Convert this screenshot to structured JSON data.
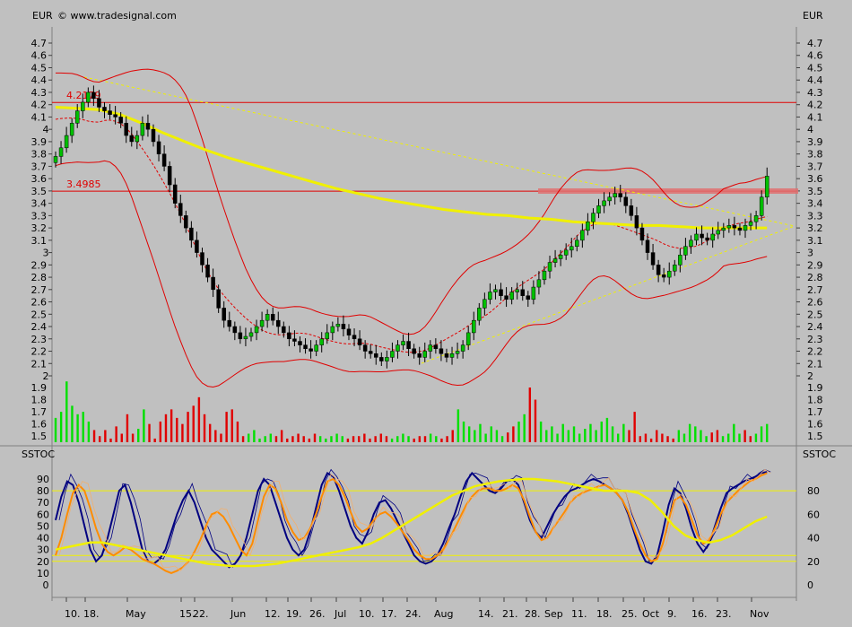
{
  "header": {
    "currency_left": "EUR",
    "currency_right": "EUR",
    "copyright": "© www.tradesignal.com"
  },
  "chart_data": [
    {
      "type": "line",
      "name_panel": "price",
      "y_ticks": [
        2,
        2.1,
        2.2,
        2.3,
        2.4,
        2.5,
        2.6,
        2.7,
        2.8,
        2.9,
        3,
        3.1,
        3.2,
        3.3,
        3.4,
        3.5,
        3.6,
        3.7,
        3.8,
        3.9,
        4,
        4.1,
        4.2,
        4.3,
        4.4,
        4.5,
        4.6,
        4.7
      ],
      "ylim": [
        1.95,
        4.8
      ],
      "x_labels": [
        "10.",
        "18.",
        "May",
        "15.",
        "22.",
        "Jun",
        "12.",
        "19.",
        "26.",
        "Jul",
        "10.",
        "17.",
        "24.",
        "Aug",
        "14.",
        "21.",
        "28.",
        "Sep",
        "11.",
        "18.",
        "25.",
        "Oct",
        "9.",
        "16.",
        "23.",
        "Nov"
      ],
      "horizontal_levels": [
        {
          "label": "4.2179",
          "value": 4.2179,
          "color": "#e00000"
        },
        {
          "label": "3.4985",
          "value": 3.4985,
          "color": "#e00000"
        }
      ],
      "closes": [
        3.78,
        3.85,
        3.95,
        4.05,
        4.15,
        4.22,
        4.3,
        4.25,
        4.18,
        4.15,
        4.12,
        4.1,
        4.05,
        3.95,
        3.9,
        3.95,
        4.05,
        4.0,
        3.9,
        3.8,
        3.7,
        3.55,
        3.4,
        3.3,
        3.2,
        3.1,
        3.0,
        2.9,
        2.8,
        2.7,
        2.55,
        2.45,
        2.4,
        2.35,
        2.3,
        2.32,
        2.35,
        2.4,
        2.45,
        2.5,
        2.45,
        2.4,
        2.35,
        2.3,
        2.28,
        2.25,
        2.22,
        2.2,
        2.25,
        2.3,
        2.35,
        2.4,
        2.42,
        2.38,
        2.33,
        2.3,
        2.25,
        2.2,
        2.18,
        2.15,
        2.12,
        2.15,
        2.2,
        2.25,
        2.28,
        2.22,
        2.18,
        2.15,
        2.2,
        2.25,
        2.22,
        2.18,
        2.15,
        2.18,
        2.2,
        2.25,
        2.35,
        2.45,
        2.55,
        2.62,
        2.68,
        2.7,
        2.65,
        2.62,
        2.68,
        2.7,
        2.65,
        2.62,
        2.72,
        2.78,
        2.85,
        2.92,
        2.95,
        2.98,
        3.02,
        3.05,
        3.1,
        3.18,
        3.25,
        3.32,
        3.38,
        3.42,
        3.45,
        3.48,
        3.45,
        3.38,
        3.3,
        3.2,
        3.1,
        3.0,
        2.9,
        2.82,
        2.8,
        2.85,
        2.9,
        2.98,
        3.05,
        3.1,
        3.15,
        3.12,
        3.1,
        3.15,
        3.18,
        3.2,
        3.22,
        3.2,
        3.18,
        3.22,
        3.25,
        3.3,
        3.45,
        3.62
      ],
      "ma_long": [
        4.18,
        4.17,
        4.16,
        4.12,
        4.05,
        3.97,
        3.9,
        3.83,
        3.77,
        3.72,
        3.67,
        3.62,
        3.57,
        3.52,
        3.48,
        3.44,
        3.41,
        3.38,
        3.35,
        3.33,
        3.31,
        3.3,
        3.28,
        3.27,
        3.25,
        3.24,
        3.23,
        3.22,
        3.22,
        3.21,
        3.2,
        3.2,
        3.2,
        3.2
      ],
      "series": [
        {
          "name": "",
          "color": "#f0f000"
        },
        {
          "name": "",
          "color": "#e00000"
        }
      ]
    },
    {
      "type": "bar",
      "name_panel": "volume",
      "y_ticks": [
        1.5,
        1.6,
        1.7,
        1.8,
        1.9
      ],
      "ylim": [
        1.45,
        2.0
      ],
      "values": [
        1.65,
        1.7,
        1.95,
        1.75,
        1.68,
        1.7,
        1.62,
        1.55,
        1.5,
        1.55,
        1.48,
        1.58,
        1.52,
        1.68,
        1.52,
        1.56,
        1.72,
        1.6,
        1.48,
        1.62,
        1.68,
        1.72,
        1.65,
        1.6,
        1.7,
        1.75,
        1.82,
        1.68,
        1.6,
        1.55,
        1.52,
        1.7,
        1.72,
        1.62,
        1.5,
        1.52,
        1.55,
        1.48,
        1.5,
        1.52,
        1.5,
        1.55,
        1.48,
        1.5,
        1.52,
        1.5,
        1.48,
        1.52,
        1.5,
        1.48,
        1.5,
        1.52,
        1.5,
        1.48,
        1.5,
        1.5,
        1.52,
        1.48,
        1.5,
        1.52,
        1.5,
        1.48,
        1.5,
        1.52,
        1.5,
        1.48,
        1.5,
        1.5,
        1.52,
        1.5,
        1.48,
        1.5,
        1.55,
        1.72,
        1.62,
        1.58,
        1.55,
        1.6,
        1.52,
        1.58,
        1.55,
        1.5,
        1.53,
        1.58,
        1.62,
        1.68,
        1.9,
        1.8,
        1.62,
        1.55,
        1.58,
        1.52,
        1.6,
        1.55,
        1.58,
        1.52,
        1.56,
        1.6,
        1.55,
        1.62,
        1.65,
        1.58,
        1.52,
        1.6,
        1.55,
        1.7,
        1.5,
        1.52,
        1.48,
        1.55,
        1.52,
        1.5,
        1.48,
        1.55,
        1.52,
        1.6,
        1.58,
        1.55,
        1.5,
        1.53,
        1.55,
        1.5,
        1.52,
        1.6,
        1.52,
        1.55,
        1.5,
        1.52,
        1.58,
        1.6
      ]
    },
    {
      "type": "line",
      "name_panel": "SSTOC",
      "label_left": "SSTOC",
      "label_right": "SSTOC",
      "y_ticks_left": [
        0,
        10,
        20,
        30,
        40,
        50,
        60,
        70,
        80,
        90
      ],
      "y_ticks_right": [
        0,
        20,
        40,
        60,
        80
      ],
      "ylim": [
        -5,
        100
      ],
      "horizontal_levels": [
        80,
        20,
        25
      ],
      "series": [
        {
          "name": "",
          "color": "#000080",
          "values": [
            55,
            75,
            88,
            85,
            70,
            50,
            30,
            20,
            25,
            40,
            60,
            80,
            85,
            70,
            50,
            30,
            20,
            18,
            22,
            30,
            45,
            60,
            72,
            80,
            70,
            55,
            40,
            30,
            25,
            20,
            15,
            18,
            25,
            40,
            60,
            80,
            90,
            85,
            70,
            55,
            40,
            30,
            25,
            30,
            45,
            65,
            85,
            95,
            92,
            80,
            65,
            50,
            40,
            35,
            45,
            60,
            70,
            72,
            65,
            55,
            45,
            35,
            25,
            20,
            18,
            20,
            25,
            35,
            48,
            60,
            75,
            88,
            95,
            90,
            85,
            80,
            78,
            82,
            88,
            90,
            85,
            70,
            55,
            45,
            40,
            50,
            60,
            68,
            75,
            80,
            82,
            85,
            88,
            90,
            88,
            85,
            82,
            78,
            72,
            60,
            45,
            30,
            20,
            18,
            25,
            45,
            68,
            82,
            78,
            65,
            48,
            35,
            28,
            35,
            50,
            65,
            78,
            82,
            85,
            88,
            90,
            92,
            95,
            96
          ]
        },
        {
          "name": "",
          "color": "#ff8c00",
          "values": [
            25,
            40,
            60,
            78,
            85,
            80,
            65,
            48,
            35,
            28,
            25,
            28,
            32,
            30,
            26,
            22,
            20,
            18,
            15,
            12,
            10,
            12,
            15,
            20,
            28,
            38,
            50,
            60,
            62,
            58,
            50,
            40,
            30,
            25,
            35,
            55,
            75,
            85,
            82,
            70,
            55,
            45,
            38,
            40,
            48,
            60,
            75,
            88,
            90,
            85,
            75,
            62,
            50,
            45,
            48,
            55,
            60,
            62,
            58,
            52,
            45,
            38,
            30,
            25,
            22,
            22,
            25,
            30,
            38,
            48,
            58,
            68,
            75,
            80,
            82,
            82,
            80,
            80,
            82,
            85,
            82,
            72,
            58,
            45,
            38,
            40,
            48,
            55,
            62,
            70,
            75,
            78,
            80,
            82,
            84,
            85,
            82,
            78,
            72,
            62,
            48,
            35,
            25,
            20,
            22,
            35,
            55,
            72,
            75,
            68,
            55,
            42,
            35,
            38,
            48,
            60,
            70,
            75,
            80,
            84,
            88,
            90,
            93,
            95
          ]
        },
        {
          "name": "",
          "color": "#f0f000",
          "values": [
            30,
            32,
            34,
            36,
            36,
            34,
            32,
            30,
            28,
            26,
            24,
            22,
            20,
            18,
            17,
            16,
            16,
            16,
            17,
            18,
            20,
            22,
            24,
            26,
            28,
            30,
            32,
            35,
            40,
            46,
            52,
            58,
            64,
            70,
            76,
            80,
            84,
            86,
            88,
            89,
            90,
            90,
            89,
            88,
            86,
            84,
            82,
            80,
            80,
            80,
            78,
            72,
            62,
            50,
            42,
            38,
            36,
            38,
            42,
            48,
            54,
            58
          ]
        }
      ]
    }
  ]
}
